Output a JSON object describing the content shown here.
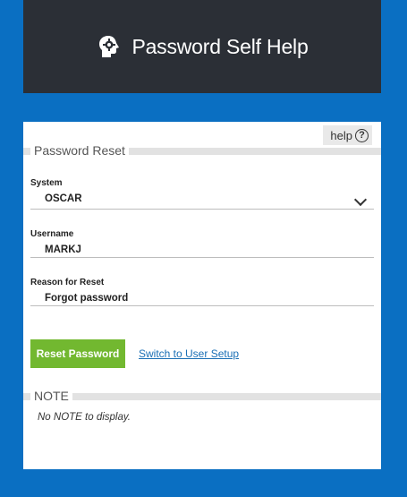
{
  "header": {
    "title": "Password Self Help",
    "logo_icon": "gear-head-icon"
  },
  "help": {
    "label": "help",
    "icon_glyph": "?"
  },
  "password_reset": {
    "section_title": "Password Reset",
    "system": {
      "label": "System",
      "value": "OSCAR"
    },
    "username": {
      "label": "Username",
      "value": "MARKJ"
    },
    "reason": {
      "label": "Reason for Reset",
      "value": "Forgot password"
    },
    "reset_button_label": "Reset Password",
    "switch_link_label": "Switch to User Setup"
  },
  "note": {
    "section_title": "NOTE",
    "empty_text": "No NOTE to display."
  },
  "colors": {
    "background": "#0a6fc2",
    "header": "#2b2f36",
    "button": "#72b830",
    "link": "#1a6fb5"
  }
}
